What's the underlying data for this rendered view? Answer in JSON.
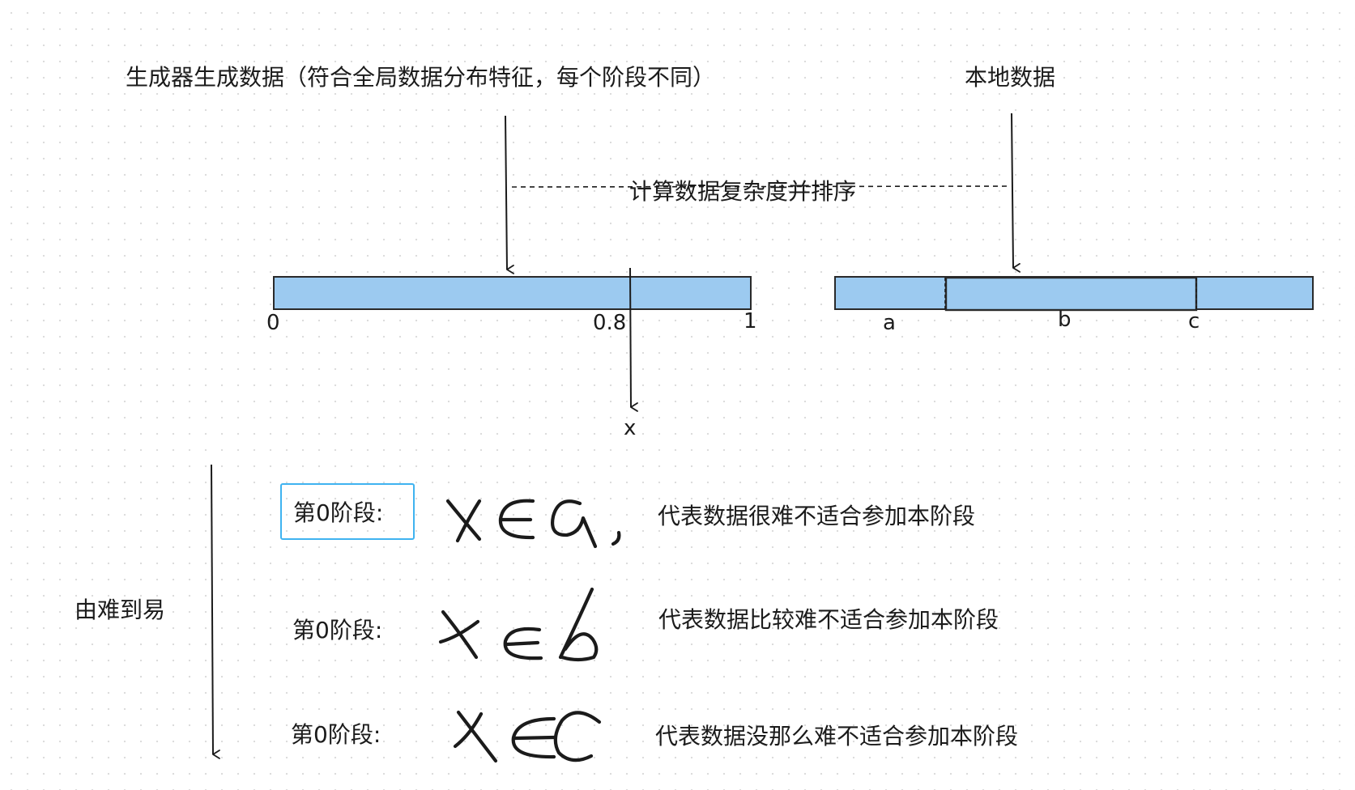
{
  "top": {
    "generator_label": "生成器生成数据（符合全局数据分布特征，每个阶段不同）",
    "local_label": "本地数据",
    "compute_label": "计算数据复杂度并排序"
  },
  "bar_left": {
    "tick_start": "0",
    "tick_threshold": "0.8",
    "tick_end": "1",
    "threshold_var": "x"
  },
  "bar_right": {
    "tick_a": "a",
    "tick_b": "b",
    "tick_c": "c"
  },
  "side_label": "由难到易",
  "stages": [
    {
      "label": "第0阶段:",
      "formula_var": "x",
      "formula_op": "∈",
      "formula_set": "a",
      "description": "代表数据很难不适合参加本阶段"
    },
    {
      "label": "第0阶段:",
      "formula_var": "x",
      "formula_op": "∈",
      "formula_set": "b",
      "description": "代表数据比较难不适合参加本阶段"
    },
    {
      "label": "第0阶段:",
      "formula_var": "x",
      "formula_op": "∈",
      "formula_set": "c",
      "description": "代表数据没那么难不适合参加本阶段"
    }
  ],
  "colors": {
    "bar_fill": "#9ccaf0",
    "bar_stroke": "#2a2a2a",
    "selection_border": "#3fb3f0",
    "line": "#1b1b1b"
  },
  "icons": [
    "arrow-down-icon"
  ]
}
